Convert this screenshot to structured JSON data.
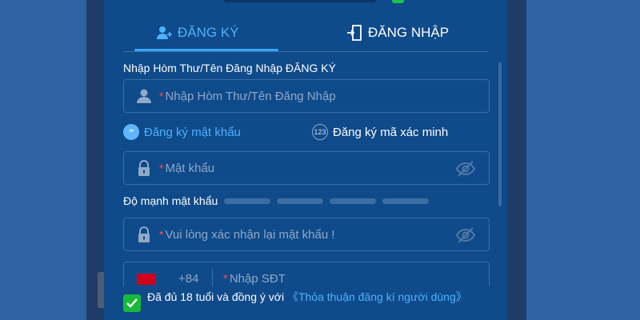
{
  "tabs": {
    "register": "ĐĂNG KÝ",
    "login": "ĐĂNG NHẬP"
  },
  "username": {
    "label": "Nhập Hòm Thư/Tên Đăng Nhập ĐĂNG KÝ",
    "required_mark": "*",
    "placeholder": "Nhập Hòm Thư/Tên Đăng Nhập"
  },
  "register_modes": {
    "password_mode": "Đăng ký mật khẩu",
    "password_badge": "**",
    "code_mode": "Đăng ký mã xác minh",
    "code_badge": "123"
  },
  "password": {
    "required_mark": "*",
    "placeholder": "Mật khẩu"
  },
  "strength": {
    "label": "Độ mạnh mật khẩu"
  },
  "confirm_password": {
    "required_mark": "*",
    "placeholder": "Vui lòng xác nhận lại mật khẩu !"
  },
  "phone": {
    "country_code": "+84",
    "required_mark": "*",
    "placeholder": "Nhập SĐT"
  },
  "agreement": {
    "text": "Đã đủ 18 tuổi và đồng ý với ",
    "link": "《Thỏa thuận đăng kí người dùng》",
    "checked": true
  },
  "colors": {
    "accent": "#4db2ff",
    "panel": "#0f4a8a",
    "background": "#2b64a0",
    "check": "#18b93a",
    "required": "#ff4a4a"
  },
  "icons": {
    "register_tab": "add-user-icon",
    "login_tab": "door-icon",
    "username_field": "user-icon",
    "password_field": "lock-icon",
    "visibility": "eye-off-icon",
    "checkbox": "checkmark-icon"
  }
}
